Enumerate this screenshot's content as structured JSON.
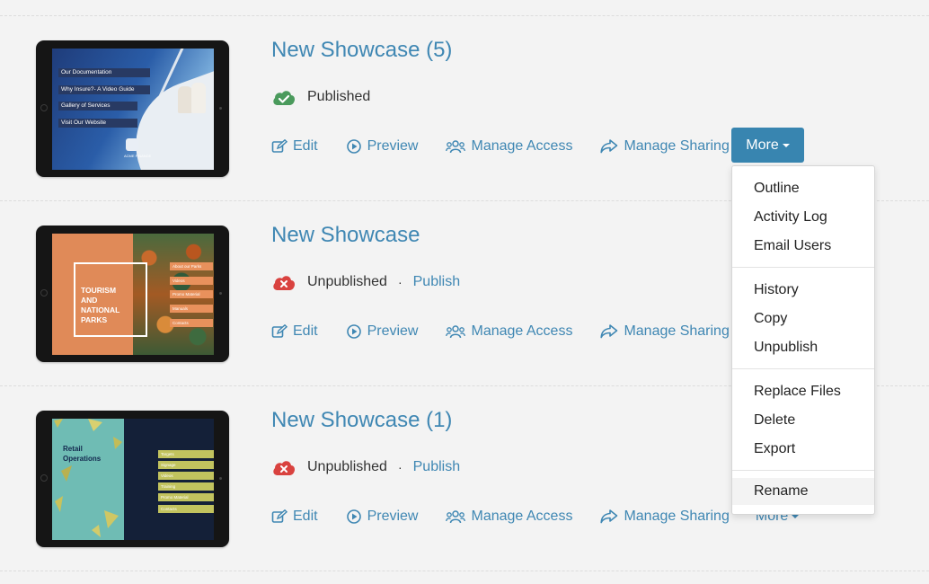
{
  "showcases": [
    {
      "title": "New Showcase (5)",
      "status": "Published",
      "status_color": "#4a9a5c",
      "publish_label": "",
      "thumbnail": {
        "menu": [
          "Our Documentation",
          "Why Insure?- A Video Guide",
          "Gallery of Services",
          "Visit Our Website"
        ],
        "logo_text": "ACME FINANCE"
      }
    },
    {
      "title": "New Showcase",
      "status": "Unpublished",
      "status_color": "#d9423f",
      "dot": "·",
      "publish_label": "Publish",
      "thumbnail": {
        "title_lines": [
          "TOURISM",
          "AND",
          "NATIONAL",
          "PARKS"
        ],
        "menu": [
          "About our Parks",
          "Videos",
          "Promo Material",
          "Manuals",
          "Contacts"
        ]
      }
    },
    {
      "title": "New Showcase (1)",
      "status": "Unpublished",
      "status_color": "#d9423f",
      "dot": "·",
      "publish_label": "Publish",
      "thumbnail": {
        "title_lines": [
          "Retail",
          "Operations"
        ],
        "menu": [
          "Targets",
          "Signage",
          "Videos",
          "Training",
          "Promo Material",
          "Contacts"
        ]
      }
    }
  ],
  "actions": {
    "edit": "Edit",
    "preview": "Preview",
    "manage_access": "Manage Access",
    "manage_sharing": "Manage Sharing",
    "more": "More"
  },
  "dropdown": {
    "groups": [
      [
        "Outline",
        "Activity Log",
        "Email Users"
      ],
      [
        "History",
        "Copy",
        "Unpublish"
      ],
      [
        "Replace Files",
        "Delete",
        "Export"
      ],
      [
        "Rename"
      ]
    ]
  },
  "colors": {
    "link": "#3f87b3",
    "accent_button": "#3885b0",
    "background": "#f3f3f3"
  }
}
